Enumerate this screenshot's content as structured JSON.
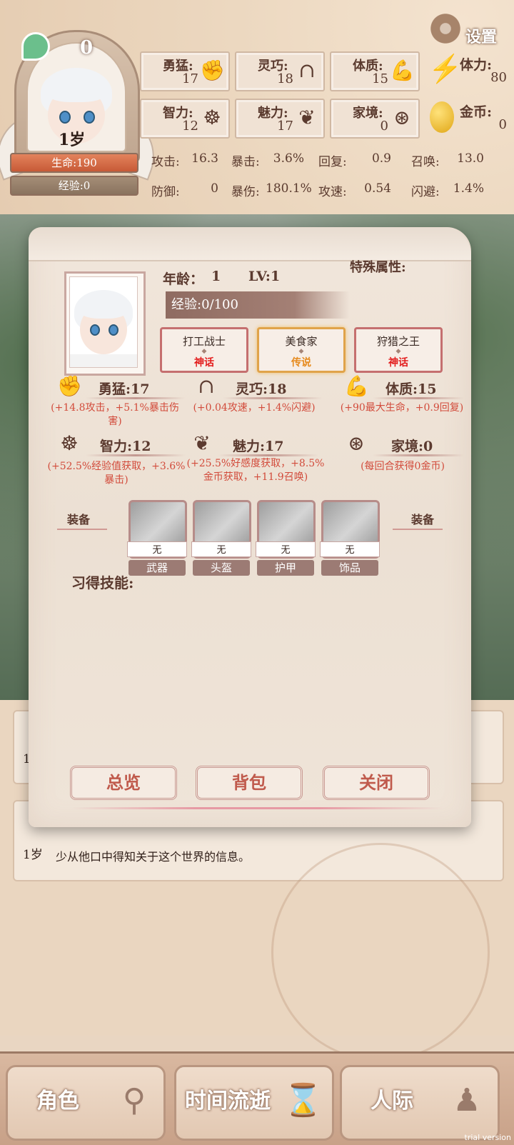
{
  "header": {
    "level": "0",
    "age": "1岁",
    "hp_label": "生命:190",
    "xp_label": "经验:0",
    "settings_label": "设置",
    "attributes": [
      {
        "label": "勇猛:",
        "value": "17",
        "icon": "fist-icon"
      },
      {
        "label": "灵巧:",
        "value": "18",
        "icon": "cloak-icon"
      },
      {
        "label": "体质:",
        "value": "15",
        "icon": "muscle-icon"
      },
      {
        "label": "智力:",
        "value": "12",
        "icon": "brain-icon"
      },
      {
        "label": "魅力:",
        "value": "17",
        "icon": "tulip-icon"
      },
      {
        "label": "家境:",
        "value": "0",
        "icon": "coin-hand-icon"
      }
    ],
    "stamina": {
      "label": "体力:",
      "value": "80"
    },
    "gold": {
      "label": "金币:",
      "value": "0"
    },
    "combat": {
      "row1": [
        {
          "label": "攻击:",
          "value": "16.3"
        },
        {
          "label": "暴击:",
          "value": "3.6%"
        },
        {
          "label": "回复:",
          "value": "0.9"
        },
        {
          "label": "召唤:",
          "value": "13.0"
        }
      ],
      "row2": [
        {
          "label": "防御:",
          "value": "0"
        },
        {
          "label": "暴伤:",
          "value": "180.1%"
        },
        {
          "label": "攻速:",
          "value": "0.54"
        },
        {
          "label": "闪避:",
          "value": "1.4%"
        }
      ]
    }
  },
  "panel": {
    "age_label": "年龄：",
    "age_value": "1",
    "lv_label": "LV:1",
    "special_label": "特殊属性:",
    "exp_label": "经验:0/100",
    "titles": [
      {
        "name": "打工战士",
        "rarity": "神话"
      },
      {
        "name": "美食家",
        "rarity": "传说"
      },
      {
        "name": "狩猎之王",
        "rarity": "神话"
      }
    ],
    "attr_details": [
      {
        "head": "勇猛:17",
        "desc": "(+14.8攻击，+5.1%暴击伤害)"
      },
      {
        "head": "灵巧:18",
        "desc": "(+0.04攻速，+1.4%闪避)"
      },
      {
        "head": "体质:15",
        "desc": "(+90最大生命，+0.9回复)"
      },
      {
        "head": "智力:12",
        "desc": "(+52.5%经验值获取，+3.6%暴击)"
      },
      {
        "head": "魅力:17",
        "desc": "(+25.5%好感度获取，+8.5%金币获取，+11.9召唤)"
      },
      {
        "head": "家境:0",
        "desc": "(每回合获得0金币)"
      }
    ],
    "equip_side_label": "装备",
    "equipment": [
      {
        "slot": "武器",
        "item": "无"
      },
      {
        "slot": "头盔",
        "item": "无"
      },
      {
        "slot": "护甲",
        "item": "无"
      },
      {
        "slot": "饰品",
        "item": "无"
      }
    ],
    "skills_label": "习得技能:",
    "buttons": {
      "overview": "总览",
      "bag": "背包",
      "close": "关闭"
    }
  },
  "log": [
    {
      "age": "1岁",
      "text": ""
    },
    {
      "age": "1岁",
      "text": "少从他口中得知关于这个世界的信息。"
    }
  ],
  "nav": [
    {
      "label": "角色",
      "icon": "character-icon"
    },
    {
      "label": "时间流逝",
      "icon": "hourglass-icon"
    },
    {
      "label": "人际",
      "icon": "people-icon"
    }
  ],
  "watermark": "trial version"
}
